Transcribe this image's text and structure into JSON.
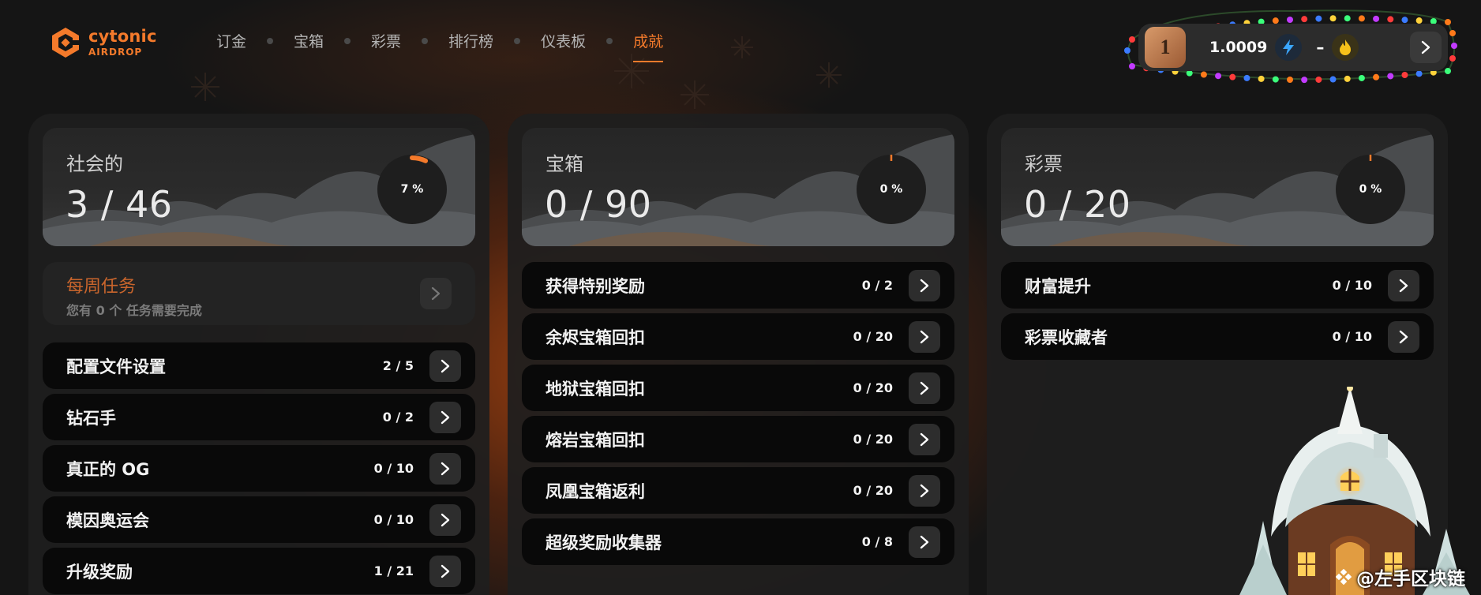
{
  "brand": {
    "name": "cytonic",
    "sub": "AIRDROP",
    "accent": "#f47a2b"
  },
  "nav": [
    {
      "label": "订金",
      "active": false
    },
    {
      "label": "宝箱",
      "active": false
    },
    {
      "label": "彩票",
      "active": false
    },
    {
      "label": "排行榜",
      "active": false
    },
    {
      "label": "仪表板",
      "active": false
    },
    {
      "label": "成就",
      "active": true
    }
  ],
  "wallet": {
    "avatar_glyph": "1",
    "balance": "1.0009",
    "secondary": "–",
    "bolt_icon": "lightning-icon",
    "flame_icon": "flame-icon"
  },
  "columns": {
    "social": {
      "title": "社会的",
      "value": "3 / 46",
      "percent_label": "7 %",
      "progress": 0.07,
      "weekly": {
        "title": "每周任务",
        "subtitle": "您有 0 个 任务需要完成"
      },
      "items": [
        {
          "label": "配置文件设置",
          "count": "2 / 5"
        },
        {
          "label": "钻石手",
          "count": "0 / 2"
        },
        {
          "label": "真正的 OG",
          "count": "0 / 10"
        },
        {
          "label": "模因奥运会",
          "count": "0 / 10"
        },
        {
          "label": "升级奖励",
          "count": "1 / 21"
        }
      ]
    },
    "chests": {
      "title": "宝箱",
      "value": "0 / 90",
      "percent_label": "0 %",
      "progress": 0,
      "items": [
        {
          "label": "获得特别奖励",
          "count": "0 / 2"
        },
        {
          "label": "余烬宝箱回扣",
          "count": "0 / 20"
        },
        {
          "label": "地狱宝箱回扣",
          "count": "0 / 20"
        },
        {
          "label": "熔岩宝箱回扣",
          "count": "0 / 20"
        },
        {
          "label": "凤凰宝箱返利",
          "count": "0 / 20"
        },
        {
          "label": "超级奖励收集器",
          "count": "0 / 8"
        }
      ]
    },
    "lottery": {
      "title": "彩票",
      "value": "0 / 20",
      "percent_label": "0 %",
      "progress": 0,
      "items": [
        {
          "label": "财富提升",
          "count": "0 / 10"
        },
        {
          "label": "彩票收藏者",
          "count": "0 / 10"
        }
      ]
    }
  },
  "watermark": "@左手区块链"
}
